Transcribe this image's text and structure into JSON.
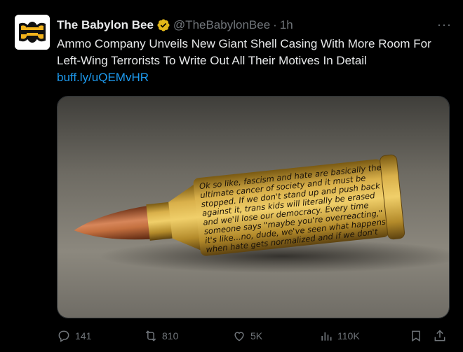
{
  "tweet": {
    "author_name": "The Babylon Bee",
    "handle": "@TheBabylonBee",
    "separator": "·",
    "time": "1h",
    "more_label": "···",
    "text": "Ammo Company Unveils New Giant Shell Casing With More Room For Left-Wing Terrorists To Write Out All Their Motives In Detail",
    "link": "buff.ly/uQEMvHR"
  },
  "media": {
    "casing_text": [
      "Ok so like, fascism and hate are basically the",
      "ultimate cancer of society and it must be",
      "stopped. If we don't stand up and push back",
      "against it, trans kids will literally be erased",
      "and we'll lose our democracy. Every time",
      "someone says \"maybe you're overreacting,\"",
      "it's like...no, dude, we've seen what happens",
      "when hate gets normalized and if we don't"
    ]
  },
  "actions": {
    "replies": "141",
    "reposts": "810",
    "likes": "5K",
    "views": "110K"
  },
  "colors": {
    "background": "#000000",
    "text": "#e7e9ea",
    "muted": "#71767b",
    "link": "#1d9bf0",
    "verified": "#e2b719",
    "brand_yellow": "#f3b31b"
  },
  "icons": [
    "babylon-bee-logo",
    "verified-badge-icon",
    "reply-icon",
    "repost-icon",
    "like-icon",
    "views-icon",
    "bookmark-icon",
    "share-icon"
  ]
}
